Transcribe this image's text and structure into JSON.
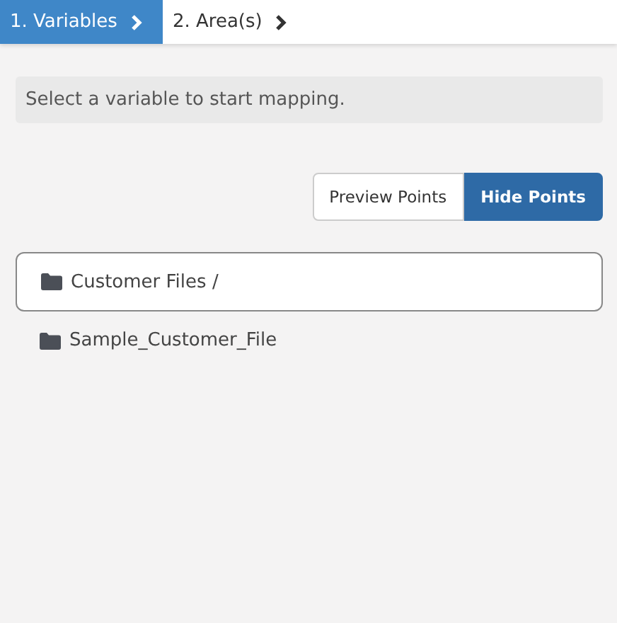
{
  "steps": [
    {
      "label": "1. Variables",
      "selected": true
    },
    {
      "label": "2. Area(s)",
      "selected": false
    }
  ],
  "message": "Select a variable to start mapping.",
  "point_buttons": [
    {
      "label": "Preview Points",
      "selected": false
    },
    {
      "label": "Hide Points",
      "selected": true
    }
  ],
  "path": "Customer Files /",
  "folders": [
    {
      "name": "Sample_Customer_File"
    }
  ]
}
